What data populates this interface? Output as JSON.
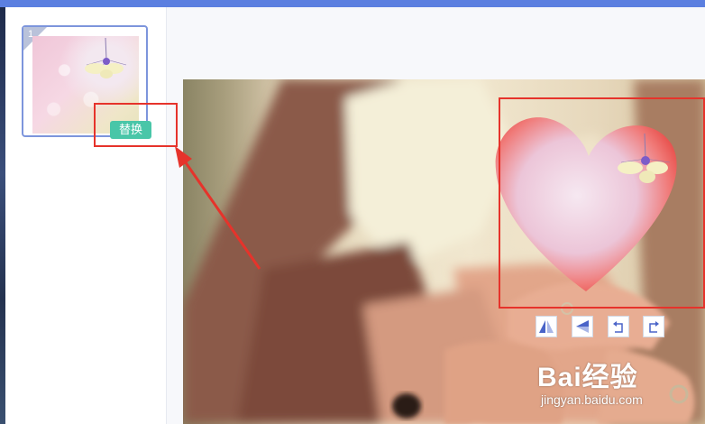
{
  "thumbnail": {
    "index": "1",
    "replace_label": "替换"
  },
  "toolbar": {
    "tools": [
      "flip-horizontal-icon",
      "flip-vertical-icon",
      "rotate-left-icon",
      "rotate-right-icon"
    ]
  },
  "watermark": {
    "logo": "Bai经验",
    "url": "jingyan.baidu.com"
  },
  "colors": {
    "top_bar": "#5b7fe0",
    "replace_button": "#49c6a8",
    "annotation_red": "#e6332b",
    "thumbnail_border": "#7d95dc"
  }
}
